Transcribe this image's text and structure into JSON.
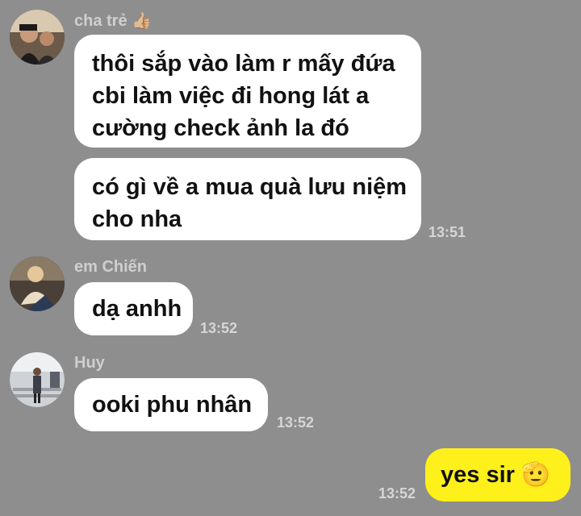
{
  "messages": {
    "group1": {
      "sender": "cha trẻ 👍🏼",
      "bubble1": [
        "thôi sắp vào làm r mấy đứa",
        "cbi làm việc đi hong lát a",
        "cường check ảnh la đó"
      ],
      "bubble2": [
        "có gì về a mua quà lưu niệm",
        "cho nha"
      ],
      "time": "13:51"
    },
    "group2": {
      "sender": "em Chiến",
      "text": "dạ anhh",
      "time": "13:52"
    },
    "group3": {
      "sender": "Huy",
      "text": "ooki phu nhân",
      "time": "13:52"
    },
    "outgoing": {
      "text": "yes sir 🫡",
      "time": "13:52"
    }
  },
  "colors": {
    "background": "#8e8e8e",
    "incoming_bubble": "#ffffff",
    "outgoing_bubble": "#fef01b"
  }
}
